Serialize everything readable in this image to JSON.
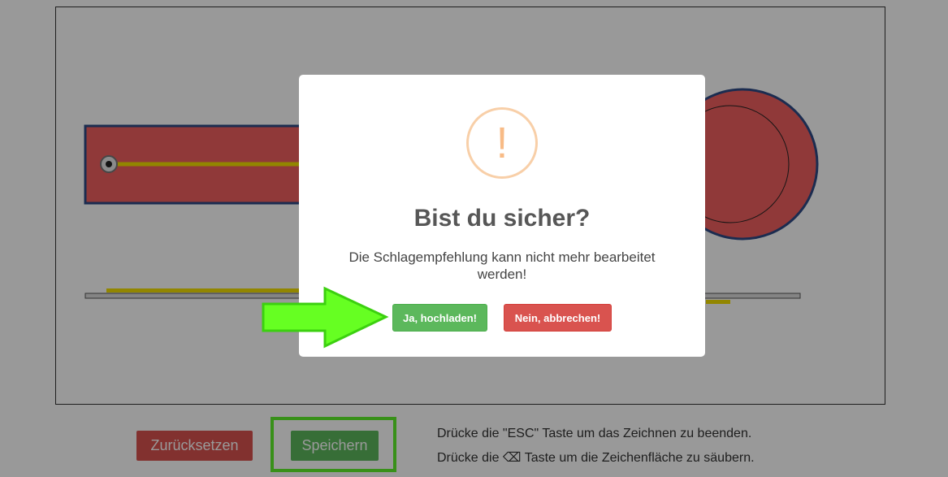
{
  "toolbar": {
    "reset_label": "Zurücksetzen",
    "save_label": "Speichern",
    "hint_esc": "Drücke die \"ESC\" Taste um das Zeichnen zu beenden.",
    "hint_backspace": "Drücke die ⌫ Taste um die Zeichenfläche zu säubern."
  },
  "dialog": {
    "icon": "warning-icon",
    "icon_glyph": "!",
    "title": "Bist du sicher?",
    "text": "Die Schlagempfehlung kann nicht mehr bearbeitet werden!",
    "confirm_label": "Ja, hochladen!",
    "cancel_label": "Nein, abbrechen!"
  },
  "colors": {
    "confirm": "#5cb85c",
    "cancel": "#d9534f",
    "highlight": "#5ef02a",
    "warning": "#f8bb86"
  }
}
